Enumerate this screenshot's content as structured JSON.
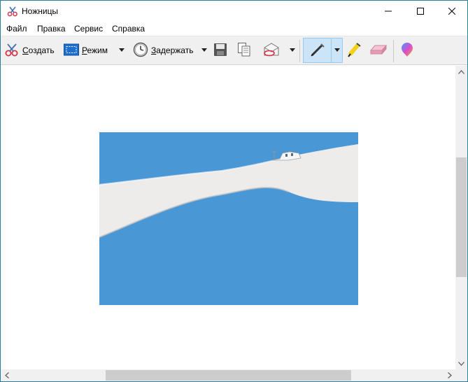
{
  "window": {
    "title": "Ножницы"
  },
  "menu": {
    "items": [
      {
        "label": "Файл"
      },
      {
        "label": "Правка"
      },
      {
        "label": "Сервис"
      },
      {
        "label": "Справка"
      }
    ]
  },
  "toolbar": {
    "new_label_first": "С",
    "new_label_rest": "оздать",
    "mode_label_first": "Р",
    "mode_label_rest": "ежим",
    "delay_label_first": "З",
    "delay_label_rest": "адержать",
    "icons": [
      "scissors-icon",
      "mode-icon",
      "clock-icon",
      "save-icon",
      "copy-icon",
      "send-email-icon",
      "pen-icon",
      "highlighter-icon",
      "eraser-icon",
      "paint3d-icon"
    ]
  },
  "colors": {
    "window_border": "#2d7d9a",
    "sky": "#4a97d6",
    "snow": "#eeecea",
    "selected_tool_bg": "#cce4f7"
  }
}
